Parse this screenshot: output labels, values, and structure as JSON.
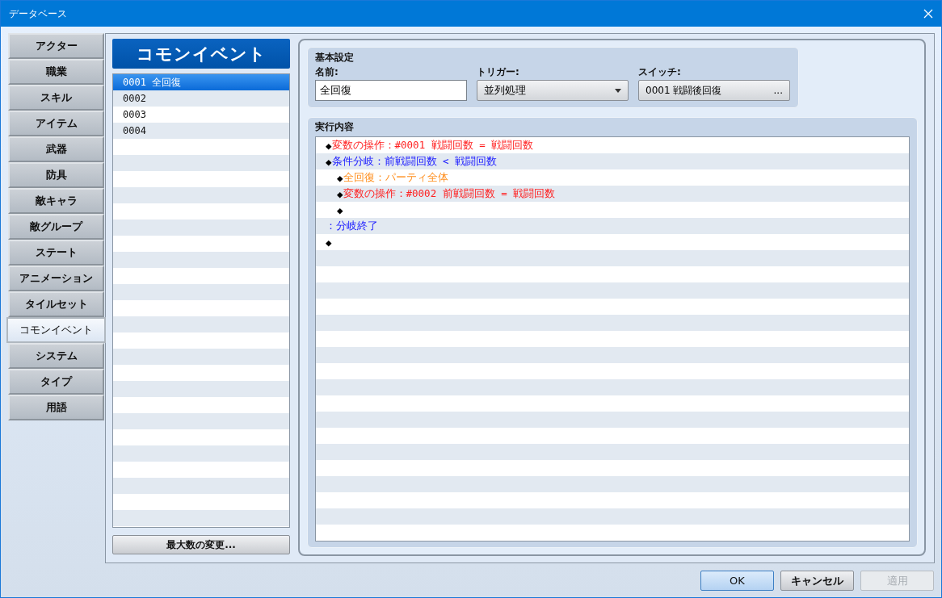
{
  "window": {
    "title": "データベース"
  },
  "tabs": [
    {
      "label": "アクター",
      "selected": false
    },
    {
      "label": "職業",
      "selected": false
    },
    {
      "label": "スキル",
      "selected": false
    },
    {
      "label": "アイテム",
      "selected": false
    },
    {
      "label": "武器",
      "selected": false
    },
    {
      "label": "防具",
      "selected": false
    },
    {
      "label": "敵キャラ",
      "selected": false
    },
    {
      "label": "敵グループ",
      "selected": false
    },
    {
      "label": "ステート",
      "selected": false
    },
    {
      "label": "アニメーション",
      "selected": false
    },
    {
      "label": "タイルセット",
      "selected": false
    },
    {
      "label": "コモンイベント",
      "selected": true
    },
    {
      "label": "システム",
      "selected": false
    },
    {
      "label": "タイプ",
      "selected": false
    },
    {
      "label": "用語",
      "selected": false
    }
  ],
  "list": {
    "heading": "コモンイベント",
    "items": [
      {
        "label": "0001 全回復",
        "selected": true
      },
      {
        "label": "0002",
        "selected": false
      },
      {
        "label": "0003",
        "selected": false
      },
      {
        "label": "0004",
        "selected": false
      }
    ],
    "button": "最大数の変更..."
  },
  "settings": {
    "heading": "基本設定",
    "name": {
      "label": "名前:",
      "value": "全回復"
    },
    "trigger": {
      "label": "トリガー:",
      "value": "並列処理"
    },
    "switch": {
      "label": "スイッチ:",
      "value": "0001 戦闘後回復",
      "button": "..."
    }
  },
  "contents": {
    "heading": "実行内容",
    "commands": [
      {
        "marker": "◆",
        "text": "変数の操作：#0001 戦闘回数 = 戦闘回数",
        "color": "#ff2020"
      },
      {
        "marker": "◆",
        "text": "条件分岐：前戦闘回数 < 戦闘回数",
        "color": "#2020ff",
        "children": [
          {
            "marker": "◆",
            "text": "全回復：パーティ全体",
            "color": "#ff9020"
          },
          {
            "marker": "◆",
            "text": "変数の操作：#0002 前戦闘回数 = 戦闘回数",
            "color": "#ff2020"
          },
          {
            "marker": "◆"
          }
        ]
      },
      {
        "text": "：分岐終了",
        "color": "#2020ff"
      },
      {
        "marker": "◆"
      }
    ]
  },
  "buttons": [
    {
      "label": "OK",
      "default": true,
      "disabled": false
    },
    {
      "label": "キャンセル",
      "default": false,
      "disabled": false
    },
    {
      "label": "適用",
      "default": false,
      "disabled": true
    }
  ]
}
